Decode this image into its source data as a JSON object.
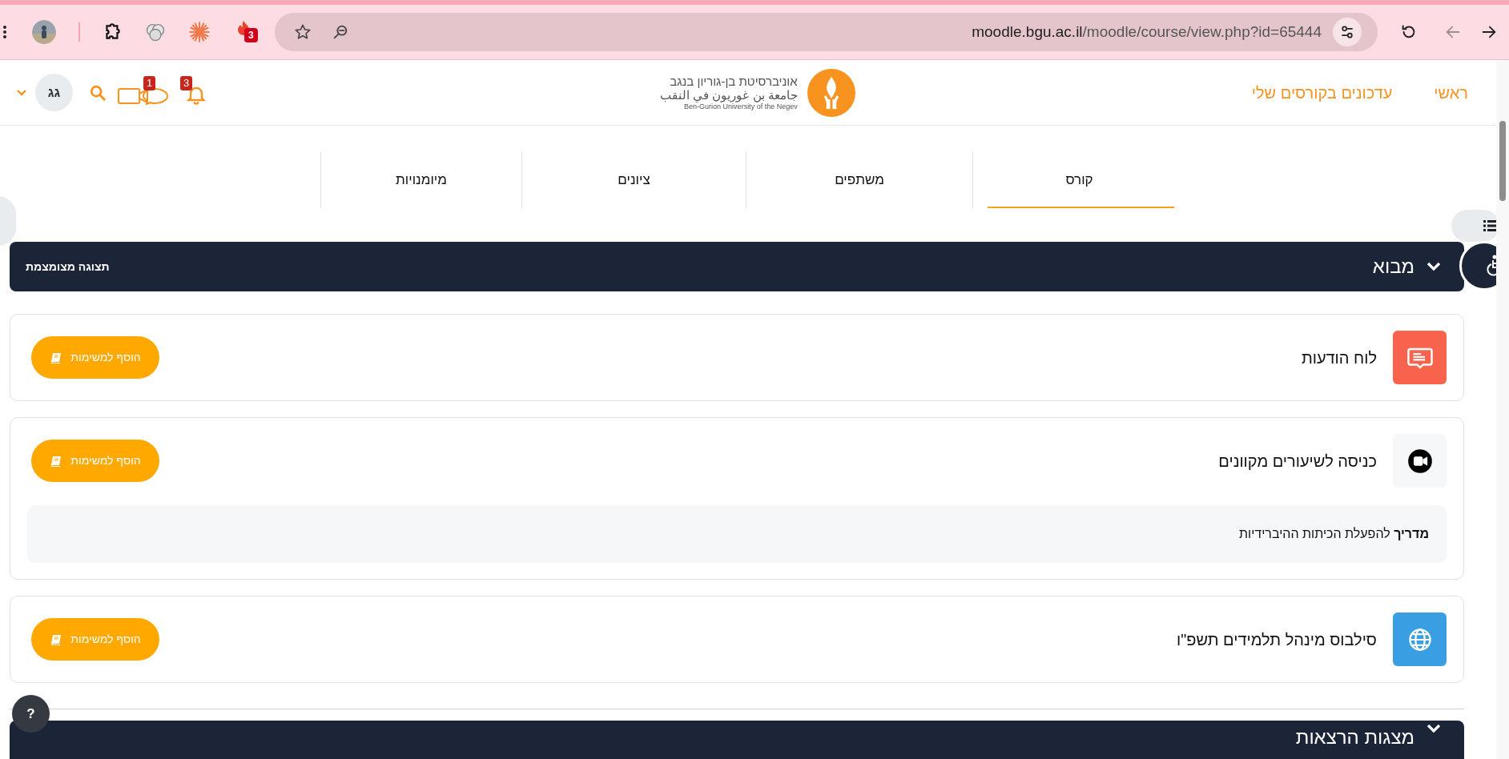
{
  "browser": {
    "extension_badge": "3",
    "url_host": "moodle.bgu.ac.il",
    "url_path": "/moodle/course/view.php?id=65444",
    "back_disabled": true
  },
  "header": {
    "avatar": "גג",
    "video_badge": "1",
    "bell_badge": "3",
    "logo_lines": [
      "אוניברסיטת בן-גוריון בנגב",
      "جامعة بن غوريون في النقب",
      "Ben-Gurion University of the Negev"
    ],
    "nav": [
      "ראשי",
      "עדכונים בקורסים שלי"
    ]
  },
  "tabs": [
    {
      "label": "קורס",
      "selected": true
    },
    {
      "label": "משתפים",
      "selected": false
    },
    {
      "label": "ציונים",
      "selected": false
    },
    {
      "label": "מיומנויות",
      "selected": false
    }
  ],
  "section": {
    "title": "מבוא",
    "expanded": true,
    "action": "תצוגה מצומצמת"
  },
  "activities": [
    {
      "kind": "forum",
      "title": "לוח הודעות",
      "button": "הוסף למשימות"
    },
    {
      "kind": "video",
      "title": "כניסה לשיעורים מקוונים",
      "button": "הוסף למשימות",
      "note": "**מדריך** להפעלת הכיתות ההיברידיות"
    },
    {
      "kind": "url",
      "title": "סילבוס מינהל תלמידים תשפ\"ו",
      "button": "הוסף למשימות"
    }
  ],
  "next_section": {
    "title": "מצגות הרצאות",
    "expanded": true
  },
  "help": "?"
}
